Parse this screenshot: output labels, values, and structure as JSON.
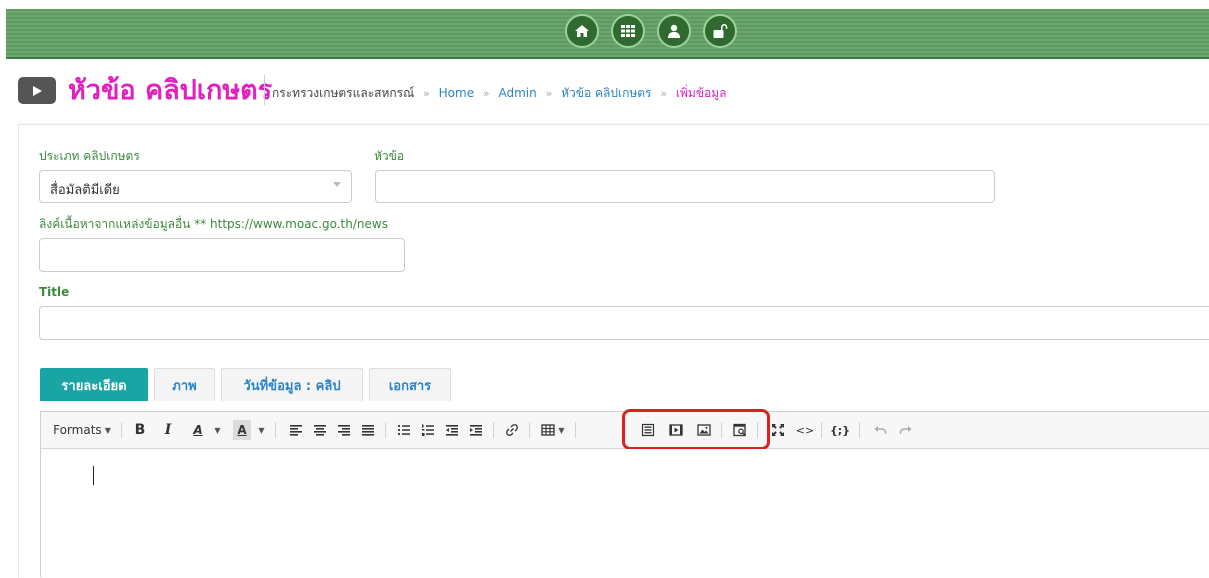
{
  "topbar": {
    "icons": [
      "home-icon",
      "grid-icon",
      "user-icon",
      "unlock-icon"
    ],
    "color": "#5f9a62"
  },
  "header": {
    "title": "หัวข้อ คลิปเกษตร",
    "title_color": "#e21fbf",
    "breadcrumb": {
      "root": "กระทรวงเกษตรและสหกรณ์",
      "home": "Home",
      "admin": "Admin",
      "section": "หัวข้อ คลิปเกษตร",
      "current": "เพิ่มข้อมูล"
    }
  },
  "form": {
    "category_label": "ประเภท คลิปเกษตร",
    "category_value": "สื่อมัลติมีเดีย",
    "topic_label": "หัวข้อ",
    "topic_value": "",
    "link_label": "ลิงค์เนื้อหาจากแหล่งข้อมูลอื่น ** https://www.moac.go.th/news",
    "link_value": "",
    "title_label": "Title",
    "title_value": ""
  },
  "tabs": [
    {
      "label": "รายละเอียด",
      "active": true
    },
    {
      "label": "ภาพ",
      "active": false
    },
    {
      "label": "วันที่ข้อมูล : คลิป",
      "active": false
    },
    {
      "label": "เอกสาร",
      "active": false
    }
  ],
  "editor": {
    "formats_label": "Formats",
    "bold_label": "B",
    "italic_label": "I",
    "font_color_label": "A",
    "bg_color_label": "A",
    "code_label": "<>",
    "variable_label": "{;}",
    "content": "",
    "highlight_color": "#e02020"
  }
}
